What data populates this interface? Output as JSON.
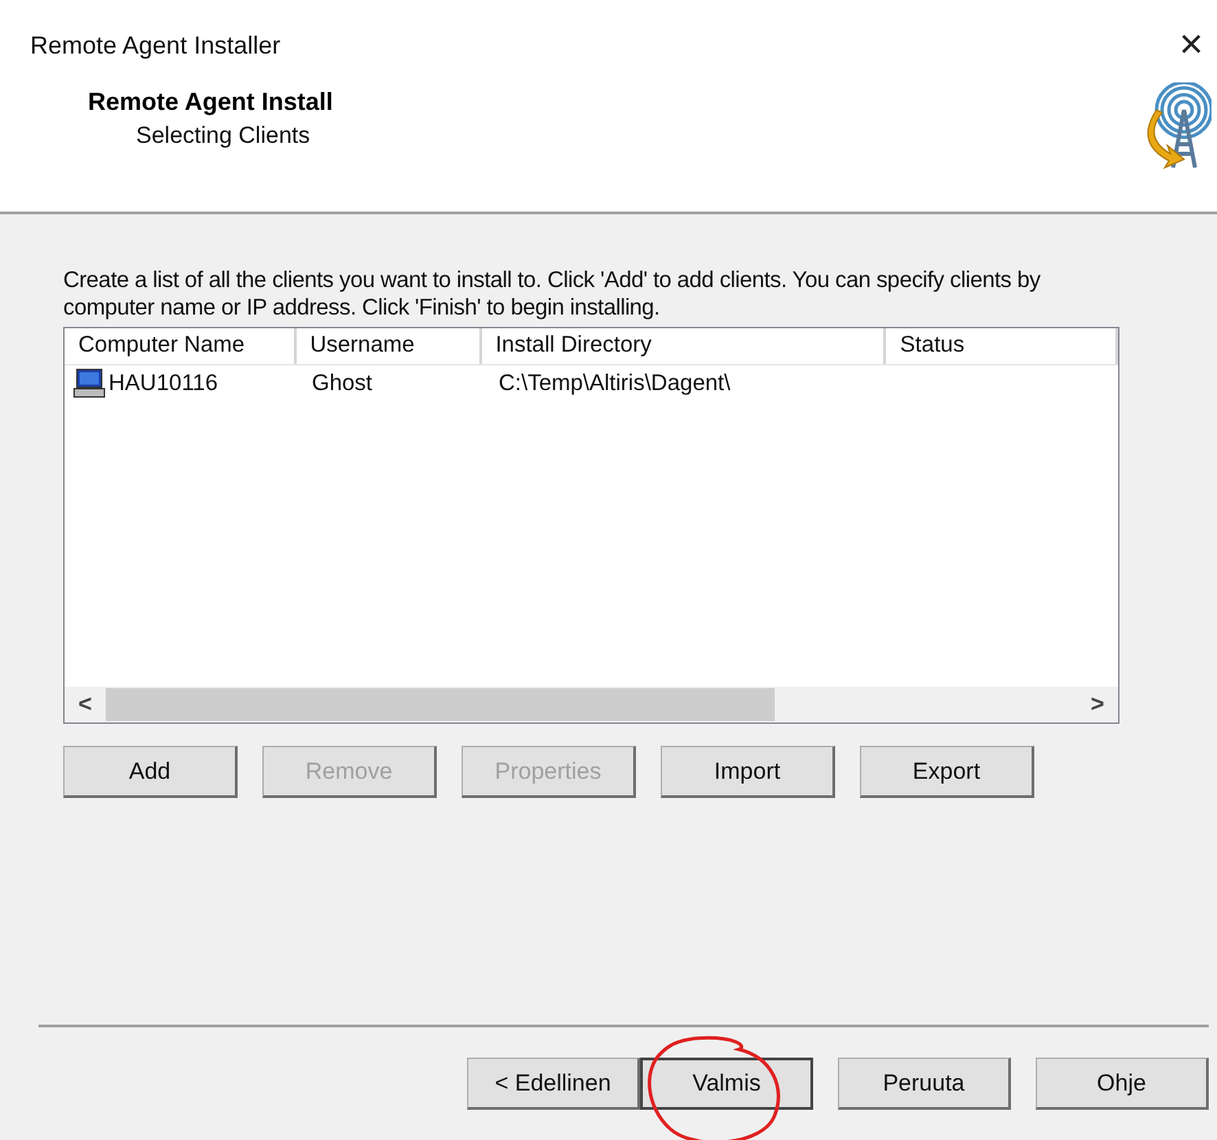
{
  "window": {
    "title": "Remote Agent Installer",
    "close": "×"
  },
  "header": {
    "title": "Remote Agent Install",
    "subtitle": "Selecting Clients"
  },
  "instructions": "Create a list of all the clients you want to install to.  Click 'Add' to add clients.  You can specify clients by computer name or IP address.  Click 'Finish' to begin installing.",
  "table": {
    "columns": [
      "Computer Name",
      "Username",
      "Install Directory",
      "Status"
    ],
    "rows": [
      {
        "cells": [
          "HAU10116",
          "Ghost",
          "C:\\Temp\\Altiris\\Dagent\\",
          ""
        ]
      }
    ],
    "scroll_left": "<",
    "scroll_right": ">"
  },
  "actions": [
    {
      "label": "Add",
      "disabled": false
    },
    {
      "label": "Remove",
      "disabled": true
    },
    {
      "label": "Properties",
      "disabled": true
    },
    {
      "label": "Import",
      "disabled": false
    },
    {
      "label": "Export",
      "disabled": false
    }
  ],
  "footer_buttons": [
    {
      "label": "< Edellinen",
      "default": false
    },
    {
      "label": "Valmis",
      "default": true
    },
    {
      "label": "Peruuta",
      "default": false
    },
    {
      "label": "Ohje",
      "default": false
    }
  ]
}
